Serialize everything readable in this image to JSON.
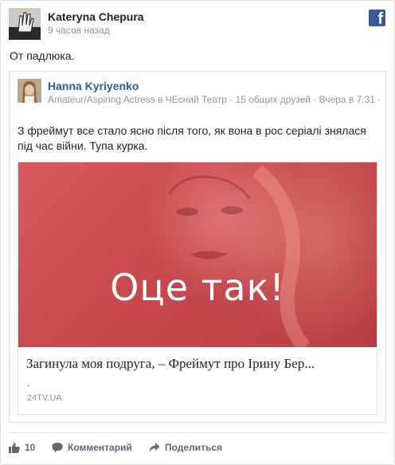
{
  "post": {
    "author": "Kateryna Chepura",
    "timestamp": "9 часов назад",
    "text": "От падлюка.",
    "brand_logo": "f"
  },
  "shared": {
    "author": "Hanna Kyriyenko",
    "meta": "Amateur/Aspiring Actress в ЧЕсний Театр · 15 общих друзей · Вчера в 7:31 ·",
    "text": "З фреймут все стало ясно після того, як вона в рос серіалі знялася під час війни. Тупа курка.",
    "link": {
      "overlay_text": "Оце так!",
      "title": "Загинула моя подруга, – Фреймут про Ірину Бер...",
      "dot": ".",
      "domain": "24TV.UA"
    }
  },
  "footer": {
    "like_count": "10",
    "comment_label": "Комментарий",
    "share_label": "Поделиться"
  },
  "colors": {
    "link_blue": "#365899",
    "facebook_blue": "#3b5998",
    "image_tint": "#c94a4f"
  }
}
